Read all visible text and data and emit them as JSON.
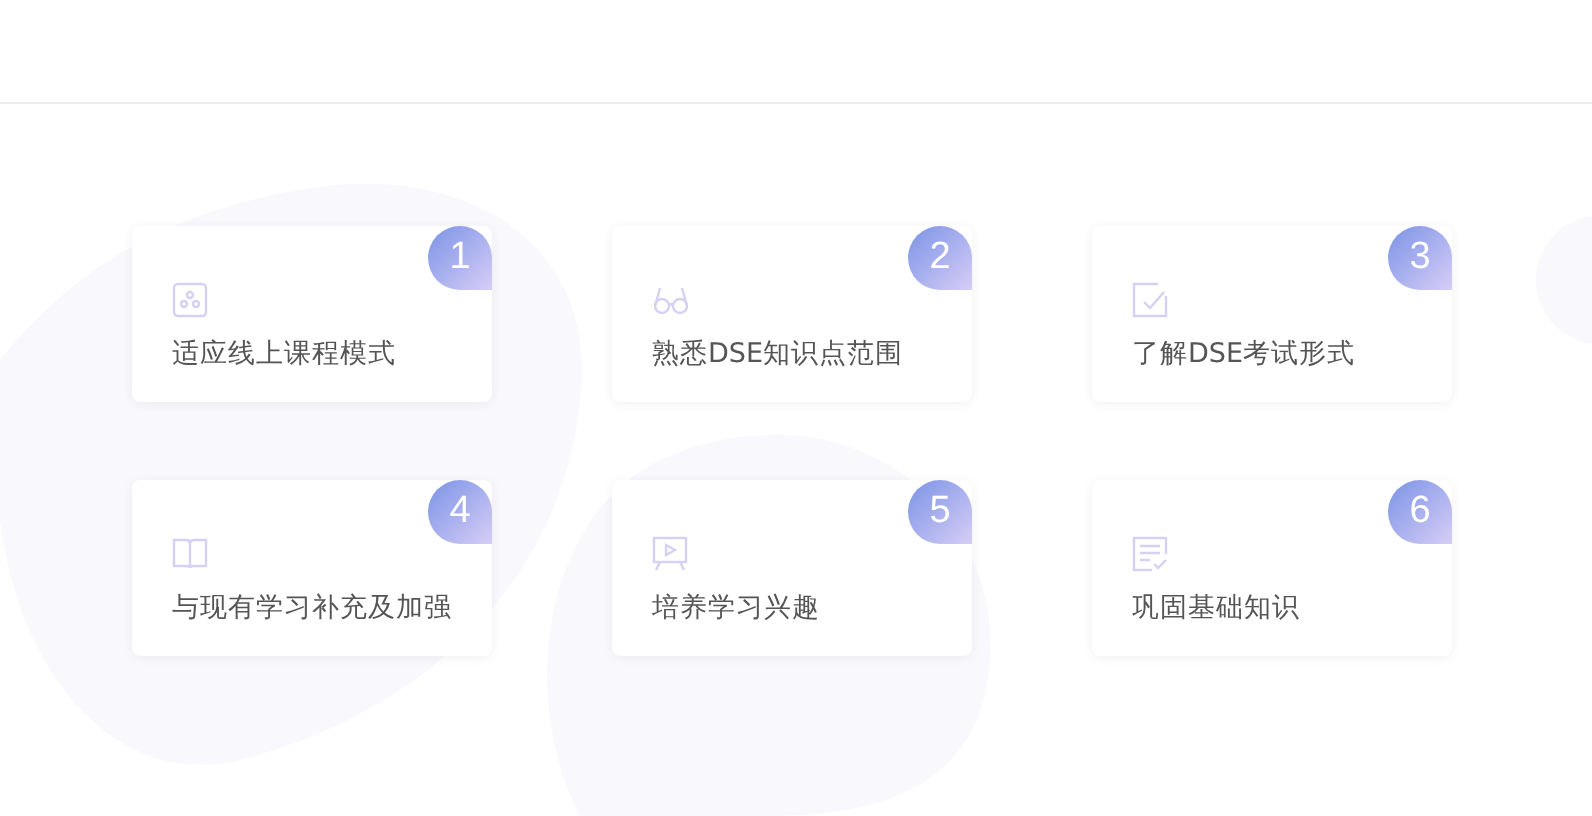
{
  "items": [
    {
      "number": "1",
      "label": "适应线上课程模式"
    },
    {
      "number": "2",
      "label": "熟悉DSE知识点范围"
    },
    {
      "number": "3",
      "label": "了解DSE考试形式"
    },
    {
      "number": "4",
      "label": "与现有学习补充及加强"
    },
    {
      "number": "5",
      "label": "培养学习兴趣"
    },
    {
      "number": "6",
      "label": "巩固基础知识"
    }
  ]
}
